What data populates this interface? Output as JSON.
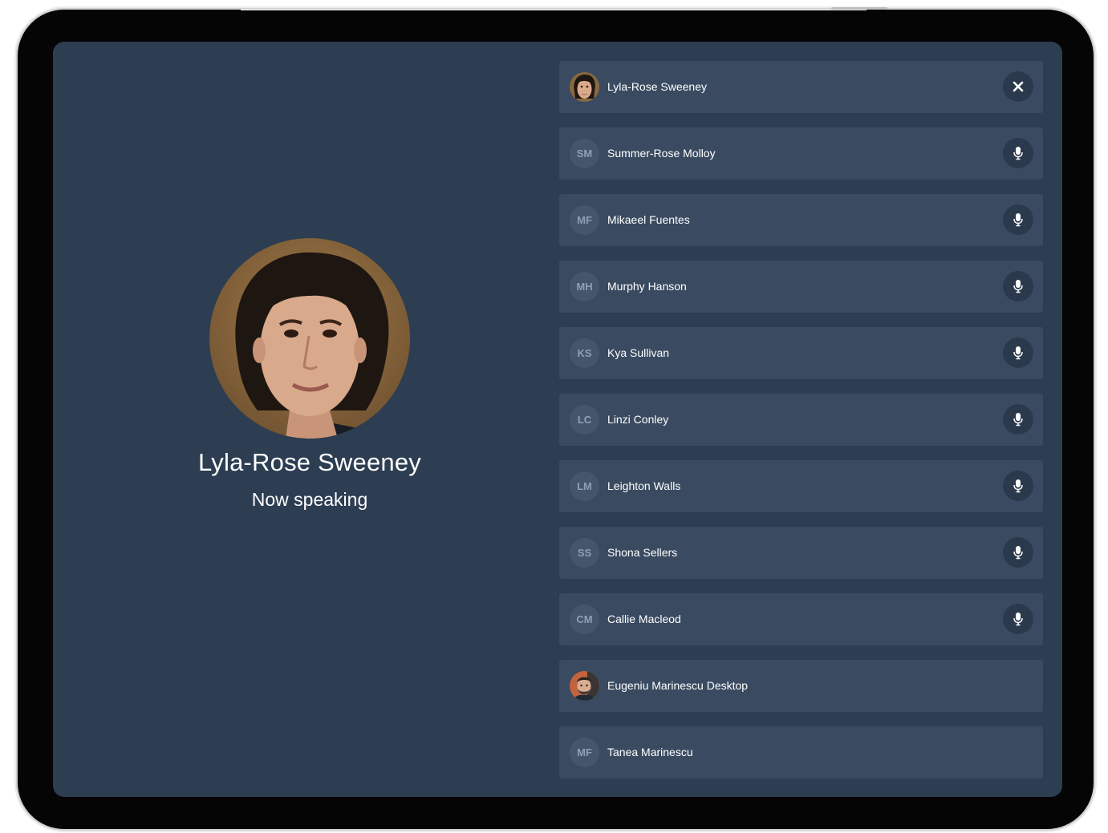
{
  "speaker": {
    "name": "Lyla-Rose Sweeney",
    "status": "Now speaking"
  },
  "participants": [
    {
      "initials": "",
      "name": "Lyla-Rose Sweeney",
      "avatar": "photo-woman",
      "action": "close-icon"
    },
    {
      "initials": "SM",
      "name": "Summer-Rose Molloy",
      "action": "microphone-icon"
    },
    {
      "initials": "MF",
      "name": "Mikaeel Fuentes",
      "action": "microphone-icon"
    },
    {
      "initials": "MH",
      "name": "Murphy Hanson",
      "action": "microphone-icon"
    },
    {
      "initials": "KS",
      "name": "Kya Sullivan",
      "action": "microphone-icon"
    },
    {
      "initials": "LC",
      "name": "Linzi Conley",
      "action": "microphone-icon"
    },
    {
      "initials": "LM",
      "name": "Leighton Walls",
      "action": "microphone-icon"
    },
    {
      "initials": "SS",
      "name": "Shona Sellers",
      "action": "microphone-icon"
    },
    {
      "initials": "CM",
      "name": "Callie Macleod",
      "action": "microphone-icon"
    },
    {
      "initials": "",
      "name": "Eugeniu Marinescu Desktop",
      "avatar": "photo-man",
      "action": ""
    },
    {
      "initials": "MF",
      "name": "Tanea Marinescu",
      "action": ""
    }
  ],
  "colors": {
    "screen_bg": "#2d3d52",
    "row_bg": "#3a4b61",
    "action_bg": "#2a394c"
  }
}
